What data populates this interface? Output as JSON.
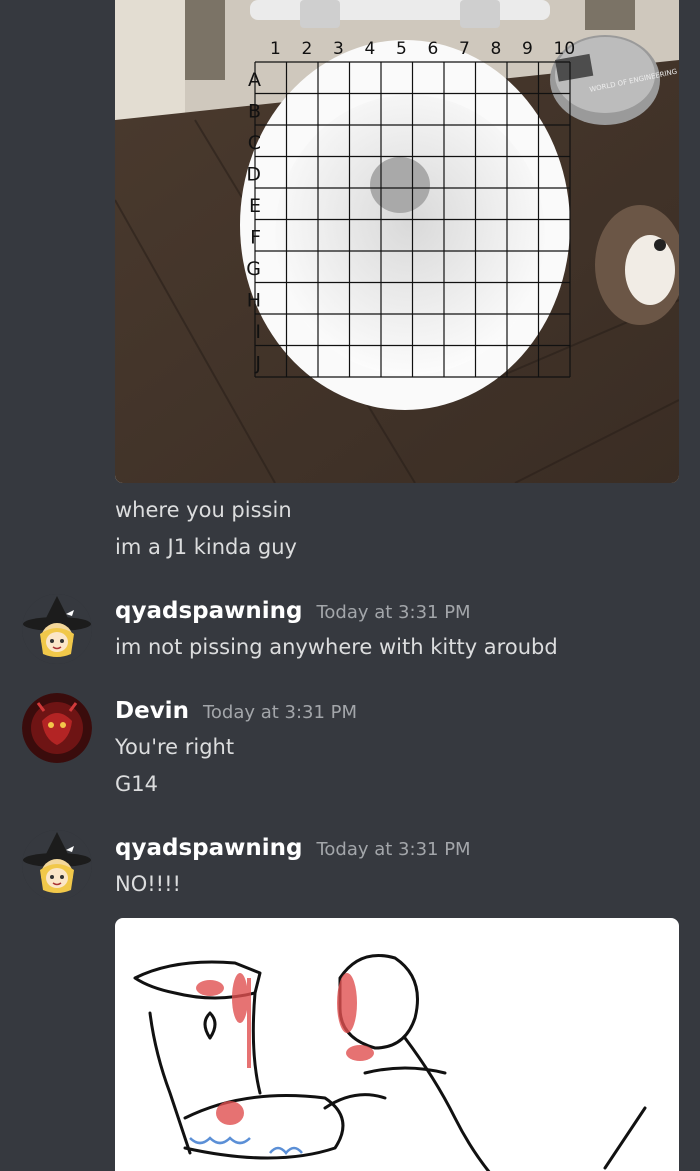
{
  "colors": {
    "background": "#36393f",
    "text": "#dcddde",
    "author": "#ffffff",
    "timestamp": "#a3a6aa"
  },
  "top_image": {
    "grid_columns": [
      "1",
      "2",
      "3",
      "4",
      "5",
      "6",
      "7",
      "8",
      "9",
      "10"
    ],
    "grid_rows": [
      "A",
      "B",
      "C",
      "D",
      "E",
      "F",
      "G",
      "H",
      "I",
      "J"
    ],
    "bin_label": "WORLD OF ENGINEERING"
  },
  "messages": [
    {
      "lines": [
        "where you pissin",
        "im a J1 kinda guy"
      ]
    },
    {
      "author": "qyadspawning",
      "timestamp": "Today at 3:31 PM",
      "avatar_icon": "witch-avatar",
      "lines": [
        "im not pissing anywhere with kitty aroubd"
      ]
    },
    {
      "author": "Devin",
      "timestamp": "Today at 3:31 PM",
      "avatar_icon": "red-mask-avatar",
      "lines": [
        "You're right",
        "G14"
      ]
    },
    {
      "author": "qyadspawning",
      "timestamp": "Today at 3:31 PM",
      "avatar_icon": "witch-avatar",
      "lines": [
        "NO!!!!"
      ]
    }
  ]
}
